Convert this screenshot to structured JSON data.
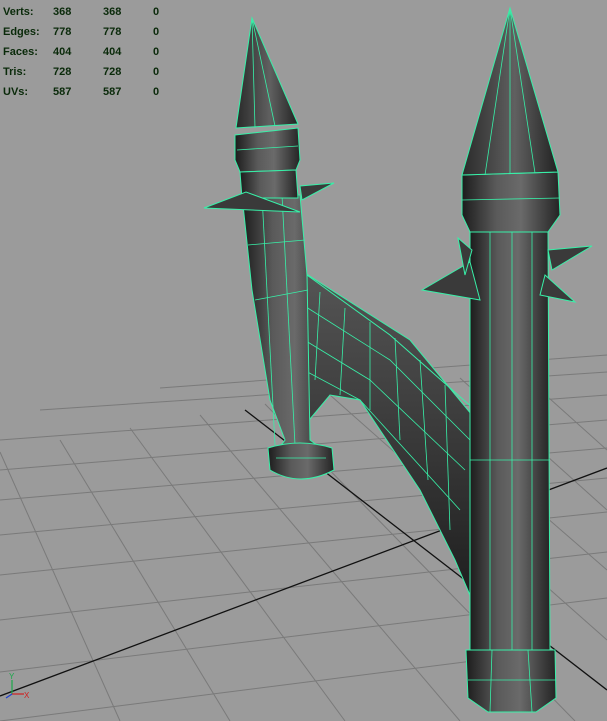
{
  "heads_up_display": {
    "rows": [
      {
        "label": "Verts:",
        "total": "368",
        "selected": "368",
        "component": "0"
      },
      {
        "label": "Edges:",
        "total": "778",
        "selected": "778",
        "component": "0"
      },
      {
        "label": "Faces:",
        "total": "404",
        "selected": "404",
        "component": "0"
      },
      {
        "label": "Tris:",
        "total": "728",
        "selected": "728",
        "component": "0"
      },
      {
        "label": "UVs:",
        "total": "587",
        "selected": "587",
        "component": "0"
      }
    ]
  },
  "axis_gizmo": {
    "y_label": "Y",
    "x_label": "X"
  },
  "colors": {
    "background": "#9b9b9b",
    "grid": "#7a7a7a",
    "grid_axis": "#111111",
    "wireframe": "#38f0a8",
    "mesh_dark": "#2e2e2e",
    "hud_text": "#0a2a0a"
  }
}
